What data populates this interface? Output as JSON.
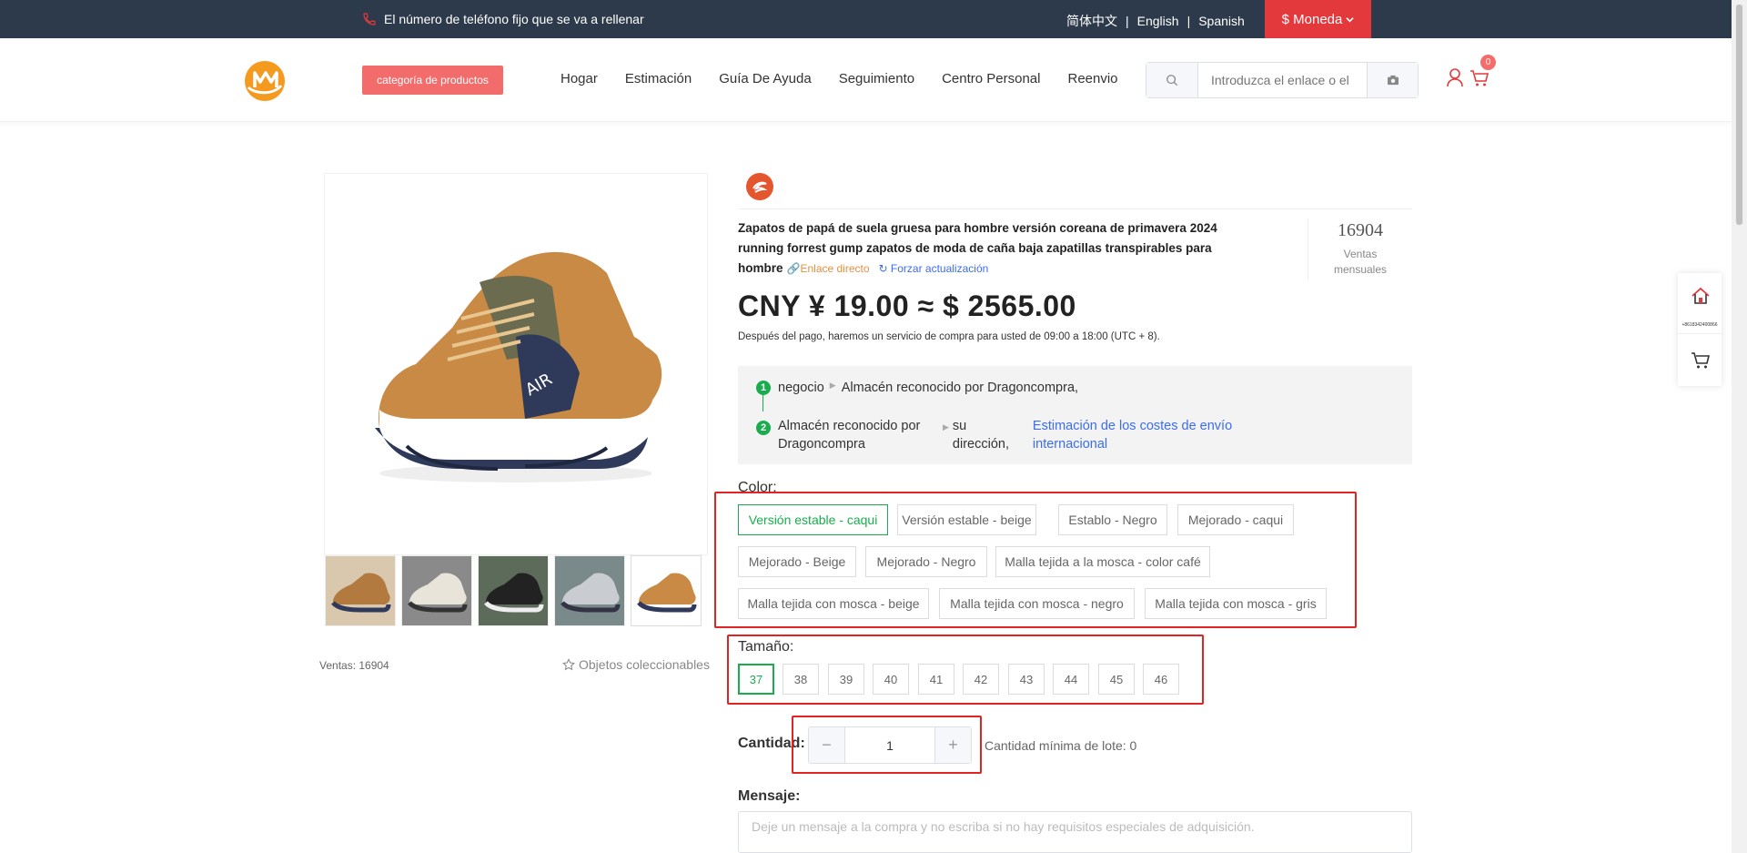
{
  "topbar": {
    "phone_text": "El número de teléfono fijo que se va a rellenar",
    "languages": [
      "简体中文",
      "English",
      "Spanish"
    ],
    "currency_label": "$ Moneda",
    "colors": {
      "background": "#2d3a4b",
      "currency_bg": "#e4393c"
    }
  },
  "header": {
    "category_button": "categoría de productos",
    "nav": [
      "Hogar",
      "Estimación",
      "Guía De Ayuda",
      "Seguimiento",
      "Centro Personal",
      "Reenvio"
    ],
    "search_placeholder": "Introduzca el enlace o el",
    "cart_count": "0"
  },
  "gallery": {
    "sales_text": "Ventas: 16904",
    "collect_text": "Objetos coleccionables",
    "thumb_icons": [
      "shoe-khaki-icon",
      "shoe-white-icon",
      "shoe-black-icon",
      "shoe-grey-icon",
      "shoe-khaki-icon"
    ]
  },
  "product": {
    "title": "Zapatos de papá de suela gruesa para hombre versión coreana de primavera 2024 running forrest gump zapatos de moda de caña baja zapatillas transpirables para hombre",
    "direct_link": "Enlace directo",
    "force_update": "Forzar actualización",
    "monthly_sales_value": "16904",
    "monthly_sales_label": "Ventas mensuales",
    "price": "CNY ¥ 19.00 ≈ $ 2565.00",
    "after_payment": "Después del pago, haremos un servicio de compra para usted de 09:00 a 18:00 (UTC + 8)."
  },
  "route": {
    "step1_num": "1",
    "step1_a": "negocio",
    "step1_b": "Almacén reconocido por Dragoncompra,",
    "step2_num": "2",
    "step2_a": "Almacén reconocido por Dragoncompra",
    "step2_b": "su dirección,",
    "step2_link": "Estimación de los costes de envío internacional"
  },
  "color": {
    "label": "Color:",
    "options": [
      "Versión estable - caqui",
      "Versión estable - beige",
      "Establo - Negro",
      "Mejorado - caqui",
      "Mejorado - Beige",
      "Mejorado - Negro",
      "Malla tejida a la mosca - color café",
      "Malla tejida con mosca - beige",
      "Malla tejida con mosca - negro",
      "Malla tejida con mosca - gris"
    ],
    "selected": "Versión estable - caqui"
  },
  "size": {
    "label": "Tamaño:",
    "options": [
      "37",
      "38",
      "39",
      "40",
      "41",
      "42",
      "43",
      "44",
      "45",
      "46"
    ],
    "selected": "37"
  },
  "quantity": {
    "label": "Cantidad:",
    "minus": "−",
    "plus": "+",
    "value": "1",
    "min_lot": "Cantidad mínima de lote: 0"
  },
  "message": {
    "label": "Mensaje:",
    "placeholder": "Deje un mensaje a la compra y no escriba si no hay requisitos especiales de adquisición."
  },
  "side_float": {
    "phone_small": "+8618342400866"
  },
  "accent_colors": {
    "selected_green": "#1aad4e",
    "highlight_red": "#e02424",
    "link_blue": "#3c6df0"
  }
}
